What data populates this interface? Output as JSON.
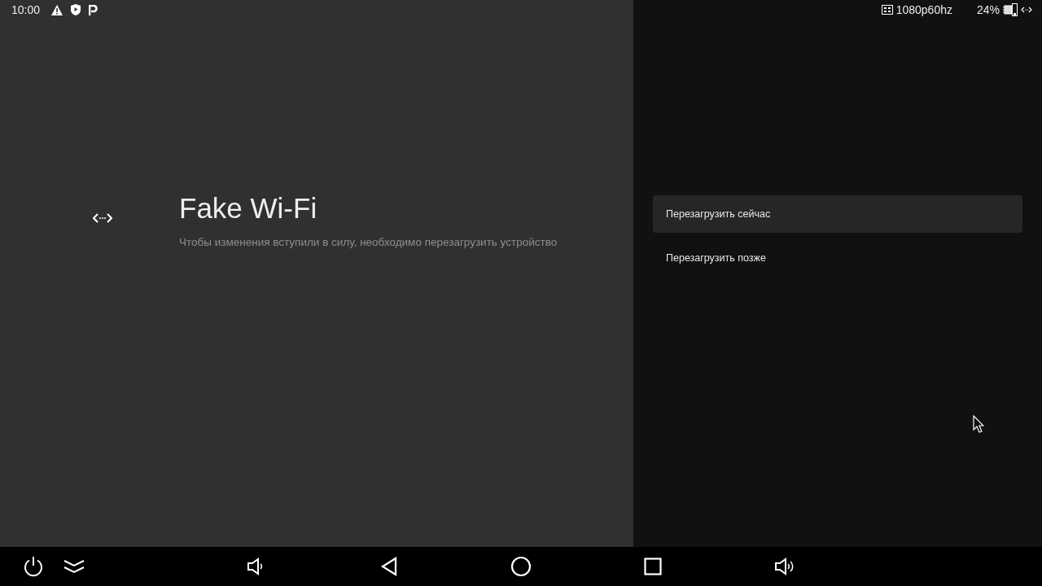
{
  "status_bar": {
    "time": "10:00",
    "resolution": "1080p60hz",
    "battery": "24%"
  },
  "guidance": {
    "title": "Fake Wi-Fi",
    "description": "Чтобы изменения вступили в силу, необходимо перезагрузить устройство"
  },
  "actions": [
    {
      "label": "Перезагрузить сейчас",
      "selected": true
    },
    {
      "label": "Перезагрузить позже",
      "selected": false
    }
  ]
}
